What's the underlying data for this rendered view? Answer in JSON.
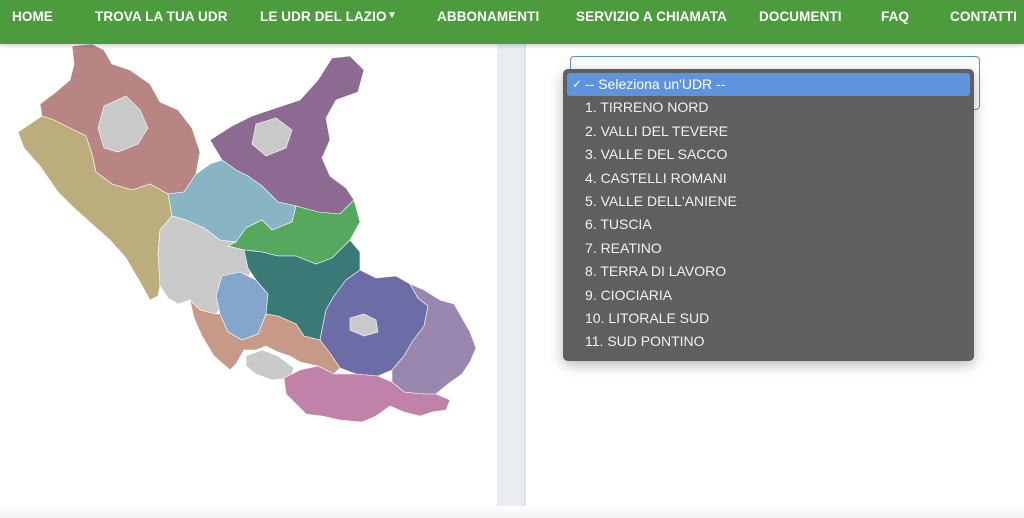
{
  "nav": {
    "items": [
      {
        "label": "HOME"
      },
      {
        "label": "TROVA LA TUA UDR"
      },
      {
        "label": "LE UDR DEL LAZIO"
      },
      {
        "label": "ABBONAMENTI"
      },
      {
        "label": "SERVIZIO A CHIAMATA"
      },
      {
        "label": "DOCUMENTI"
      },
      {
        "label": "FAQ"
      },
      {
        "label": "CONTATTI"
      }
    ],
    "dropdown_caret": "▼"
  },
  "colors": {
    "nav_bg": "#4c9c3e",
    "dropdown_bg": "#5f5f5f",
    "selected_bg": "#5e93dd"
  },
  "udr_select": {
    "check_glyph": "✓",
    "options": [
      {
        "label": "-- Seleziona un'UDR --",
        "selected": true
      },
      {
        "label": "1. TIRRENO NORD"
      },
      {
        "label": "2. VALLI DEL TEVERE"
      },
      {
        "label": "3. VALLE DEL SACCO"
      },
      {
        "label": "4. CASTELLI ROMANI"
      },
      {
        "label": "5. VALLE DELL'ANIENE"
      },
      {
        "label": "6. TUSCIA"
      },
      {
        "label": "7. REATINO"
      },
      {
        "label": "8. TERRA DI LAVORO"
      },
      {
        "label": "9. CIOCIARIA"
      },
      {
        "label": "10. LITORALE SUD"
      },
      {
        "label": "11. SUD PONTINO"
      }
    ]
  },
  "map": {
    "regions": [
      {
        "name": "tuscia-north",
        "color": "#b98583"
      },
      {
        "name": "tuscia-west",
        "color": "#bcae7c"
      },
      {
        "name": "tirreno-inland",
        "color": "#b98583"
      },
      {
        "name": "reatino",
        "color": "#8c6a92"
      },
      {
        "name": "valli-tevere",
        "color": "#88b4c4"
      },
      {
        "name": "valle-aniene",
        "color": "#55a85e"
      },
      {
        "name": "roma",
        "color": "#c9c9c9"
      },
      {
        "name": "castelli",
        "color": "#84a6cc"
      },
      {
        "name": "valle-sacco",
        "color": "#3a7a76"
      },
      {
        "name": "ciociaria",
        "color": "#6c6ca6"
      },
      {
        "name": "terra-lavoro",
        "color": "#9a87b0"
      },
      {
        "name": "litorale",
        "color": "#c69a86"
      },
      {
        "name": "sud-pontino",
        "color": "#c082a8"
      }
    ]
  }
}
